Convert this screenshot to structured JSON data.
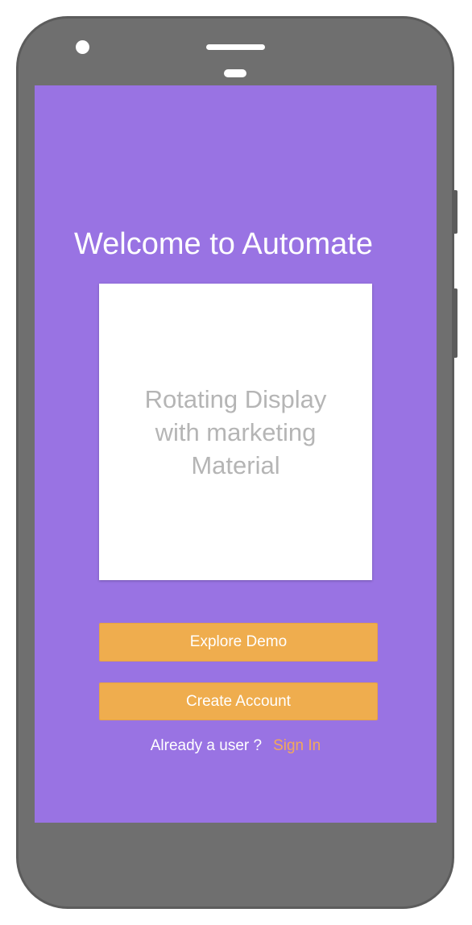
{
  "welcome": {
    "title": "Welcome to Automate"
  },
  "marketing": {
    "text": "Rotating Display\nwith marketing\nMaterial"
  },
  "actions": {
    "explore_label": "Explore Demo",
    "create_label": "Create Account"
  },
  "signin": {
    "prompt": "Already a user ?",
    "link_label": "Sign In"
  },
  "colors": {
    "screen_bg": "#9973e3",
    "button_bg": "#efad4e",
    "link": "#f2a95a",
    "device_body": "#6f6f6f"
  },
  "icons": {
    "camera": "front-camera-icon",
    "speaker": "speaker-grille-icon",
    "sensor": "proximity-sensor-icon"
  }
}
